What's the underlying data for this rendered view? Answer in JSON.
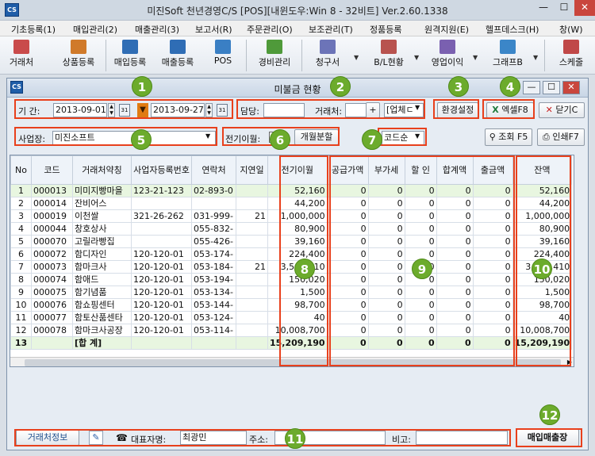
{
  "app": {
    "title": "미진Soft 천년경영C/S [POS][내윈도우:Win 8 - 32비트] Ver.2.60.1338",
    "icon_text": "CS"
  },
  "window_controls": {
    "minimize": "—",
    "maximize": "☐",
    "close": "✕"
  },
  "menu": [
    "기초등록(1)",
    "매입관리(2)",
    "매출관리(3)",
    "보고서(R)",
    "주문관리(O)",
    "보조관리(T)",
    "정품등록",
    "원격지원(E)",
    "헬프데스크(H)",
    "창(W)"
  ],
  "toolbar": [
    {
      "label": "거래처",
      "icon": "customer-card-icon",
      "color": "#c94b4b"
    },
    {
      "label": "상품등록",
      "icon": "product-icon",
      "color": "#d07a2a"
    },
    {
      "label": "매입등록",
      "icon": "purchase-icon",
      "color": "#2f6db5"
    },
    {
      "label": "매출등록",
      "icon": "sales-icon",
      "color": "#2f6db5"
    },
    {
      "label": "POS",
      "icon": "pos-icon",
      "color": "#3a7fc4"
    },
    {
      "label": "경비관리",
      "icon": "expense-icon",
      "color": "#4f9a3a"
    },
    {
      "label": "청구서",
      "icon": "invoice-icon",
      "color": "#6c74b8"
    },
    {
      "label": "B/L현황",
      "icon": "bl-status-icon",
      "color": "#b8534f"
    },
    {
      "label": "영업이익",
      "icon": "profit-icon",
      "color": "#7a60b0"
    },
    {
      "label": "그래프B",
      "icon": "chart-icon",
      "color": "#3b86c8"
    },
    {
      "label": "스케줄",
      "icon": "calendar-icon",
      "color": "#c04848"
    }
  ],
  "child_window": {
    "title": "미불금 현황",
    "icon_text": "CS"
  },
  "filters": {
    "period_label": "기 간:",
    "date_from": "2013-09-01",
    "date_to": "2013-09-27",
    "manager_label": "담당:",
    "manager_value": "",
    "customer_label": "거래처:",
    "customer_value": "",
    "plus": "+",
    "type_select": "[업체ㄷ",
    "settings_button": "환경설정",
    "excel_button": "엑셀F8",
    "close_button": "닫기C",
    "business_label": "사업장:",
    "business_value": "미진소프트",
    "carryover_label": "전기이월:",
    "carryover_checkbox": "",
    "monthly_split": "개월분할",
    "sort_select": "코드순",
    "search_button": "조회 F5",
    "print_button": "인쇄F7"
  },
  "badges": [
    "1",
    "2",
    "3",
    "4",
    "5",
    "6",
    "7",
    "8",
    "9",
    "10",
    "11",
    "12"
  ],
  "table": {
    "columns": [
      "No",
      "코드",
      "거래처약칭",
      "사업자등록번호",
      "연락처",
      "지연일",
      "전기이월",
      "공급가액",
      "부가세",
      "할 인",
      "합계액",
      "출금액",
      "잔액"
    ],
    "rows": [
      [
        "1",
        "000013",
        "미미지빵마을",
        "123-21-123",
        "02-893-0",
        "",
        "52,160",
        "0",
        "0",
        "0",
        "0",
        "0",
        "52,160"
      ],
      [
        "2",
        "000014",
        "잔비어스",
        "",
        "",
        "",
        "44,200",
        "0",
        "0",
        "0",
        "0",
        "0",
        "44,200"
      ],
      [
        "3",
        "000019",
        "이천쌀",
        "321-26-262",
        "031-999-",
        "21",
        "1,000,000",
        "0",
        "0",
        "0",
        "0",
        "0",
        "1,000,000"
      ],
      [
        "4",
        "000044",
        "창호상사",
        "",
        "055-832-",
        "",
        "80,900",
        "0",
        "0",
        "0",
        "0",
        "0",
        "80,900"
      ],
      [
        "5",
        "000070",
        "고릴라빵집",
        "",
        "055-426-",
        "",
        "39,160",
        "0",
        "0",
        "0",
        "0",
        "0",
        "39,160"
      ],
      [
        "6",
        "000072",
        "함디자인",
        "120-120-01",
        "053-174-",
        "",
        "224,400",
        "0",
        "0",
        "0",
        "0",
        "0",
        "224,400"
      ],
      [
        "7",
        "000073",
        "함마크사",
        "120-120-01",
        "053-184-",
        "21",
        "3,500,410",
        "0",
        "0",
        "0",
        "0",
        "0",
        "3,500,410"
      ],
      [
        "8",
        "000074",
        "함애드",
        "120-120-01",
        "053-194-",
        "",
        "150,020",
        "0",
        "0",
        "0",
        "0",
        "0",
        "150,020"
      ],
      [
        "9",
        "000075",
        "함기념품",
        "120-120-01",
        "053-134-",
        "",
        "1,500",
        "0",
        "0",
        "0",
        "0",
        "0",
        "1,500"
      ],
      [
        "10",
        "000076",
        "함쇼핑센터",
        "120-120-01",
        "053-144-",
        "",
        "98,700",
        "0",
        "0",
        "0",
        "0",
        "0",
        "98,700"
      ],
      [
        "11",
        "000077",
        "함토산품센타",
        "120-120-01",
        "053-124-",
        "",
        "40",
        "0",
        "0",
        "0",
        "0",
        "0",
        "40"
      ],
      [
        "12",
        "000078",
        "함마크사공장",
        "120-120-01",
        "053-114-",
        "",
        "10,008,700",
        "0",
        "0",
        "0",
        "0",
        "0",
        "10,008,700"
      ]
    ],
    "total": [
      "13",
      "",
      "[합 계]",
      "",
      "",
      "",
      "15,209,190",
      "0",
      "0",
      "0",
      "0",
      "0",
      "15,209,190"
    ]
  },
  "status": {
    "customer_info_label": "거래처정보",
    "phone_icon": "phone-icon",
    "rep_label": "대표자명:",
    "rep_value": "최광민",
    "address_label": "주소:",
    "address_value": "",
    "note_label": "비고:",
    "note_value": "",
    "purchase_sales_button": "매입매출장"
  },
  "colors": {
    "highlight": "#e8401c",
    "badge": "#6cab2c",
    "total_row": "#e8f6e0"
  }
}
